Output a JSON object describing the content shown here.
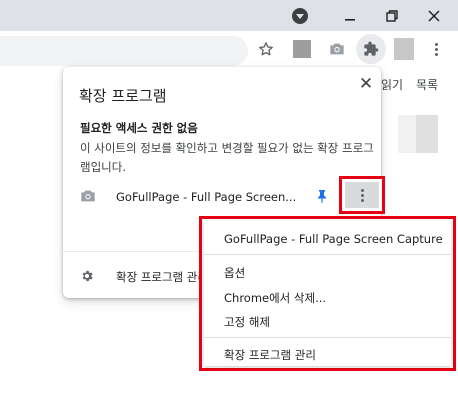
{
  "browser": {
    "icons": {
      "profile": "profile-menu-icon",
      "minimize": "minimize-icon",
      "restore": "restore-icon",
      "close": "close-icon",
      "star": "star-icon",
      "camera": "camera-icon",
      "extensions": "puzzle-icon",
      "menu": "vertical-dots-icon"
    },
    "bookmarks": [
      "읽기",
      "목록"
    ]
  },
  "popup": {
    "title": "확장 프로그램",
    "close_glyph": "✕",
    "section_title": "필요한 액세스 권한 없음",
    "section_desc": "이 사이트의 정보를 확인하고 변경할 필요가 없는 확장 프로그램입니다.",
    "extension": {
      "name": "GoFullPage - Full Page Screen...",
      "icon": "camera-icon",
      "pin_icon": "pin-icon",
      "more_icon": "vertical-dots-icon"
    },
    "manage_label": "확장 프로그램 관리"
  },
  "context_menu": {
    "items": [
      "GoFullPage - Full Page Screen Capture",
      "옵션",
      "Chrome에서 삭제...",
      "고정 해제",
      "확장 프로그램 관리"
    ]
  },
  "colors": {
    "highlight": "#e60012",
    "pin": "#1a73e8",
    "tab_strip": "#dee1e6",
    "omnibox": "#f1f3f4"
  }
}
